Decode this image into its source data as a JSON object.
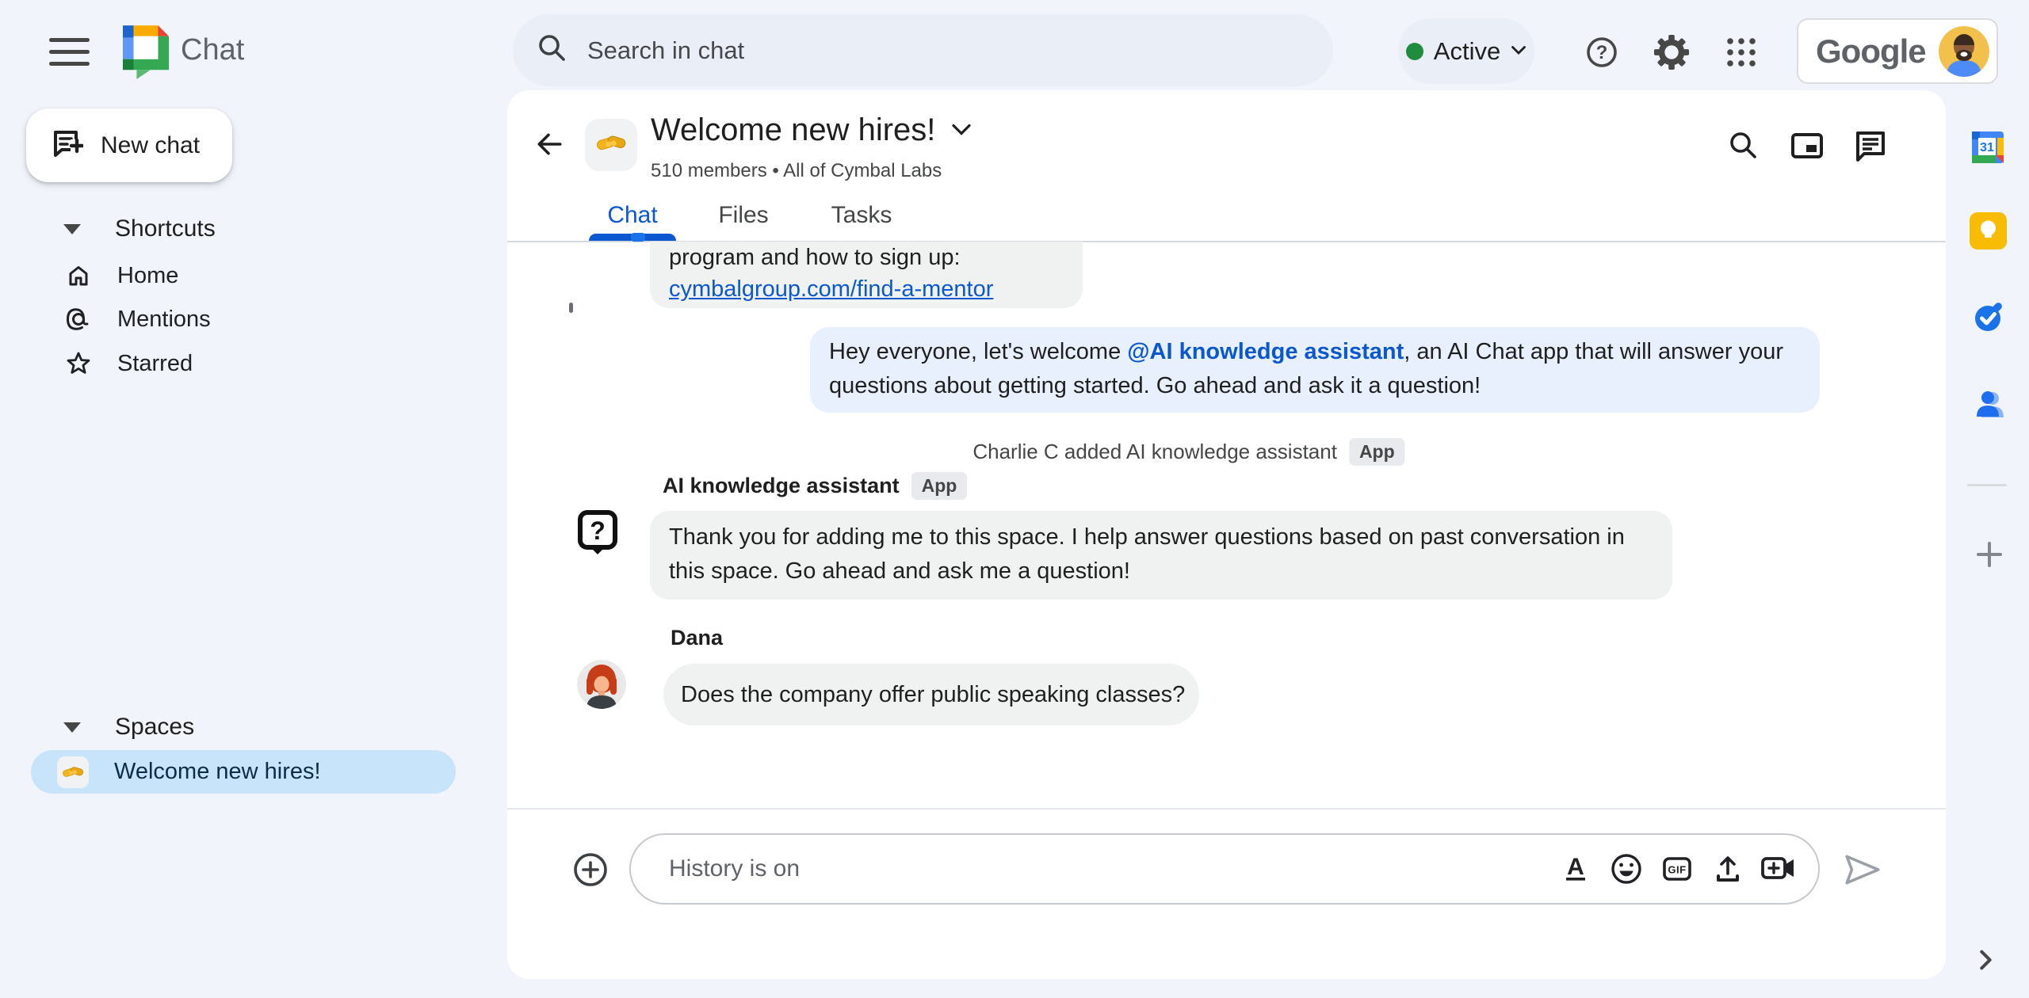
{
  "topbar": {
    "app_name": "Chat",
    "search": {
      "placeholder": "Search in chat"
    },
    "status": {
      "label": "Active"
    },
    "icons": [
      "help-icon",
      "settings-gear-icon",
      "apps-grid-icon"
    ],
    "account": {
      "brand": "Google"
    }
  },
  "sidebar": {
    "new_chat_label": "New chat",
    "shortcuts": {
      "label": "Shortcuts",
      "items": [
        {
          "label": "Home",
          "icon": "home-icon"
        },
        {
          "label": "Mentions",
          "icon": "at-mention-icon"
        },
        {
          "label": "Starred",
          "icon": "star-icon"
        }
      ]
    },
    "spaces": {
      "label": "Spaces",
      "items": [
        {
          "label": "Welcome new hires!",
          "emoji": "handshake",
          "selected": true
        }
      ]
    }
  },
  "chat_header": {
    "title": "Welcome new hires!",
    "emoji": "handshake",
    "subtitle": "510 members  •  All of Cymbal Labs",
    "tabs": [
      {
        "label": "Chat",
        "active": true
      },
      {
        "label": "Files",
        "active": false
      },
      {
        "label": "Tasks",
        "active": false
      }
    ],
    "action_icons": [
      "search-icon",
      "picture-in-picture-icon",
      "chat-threads-icon"
    ]
  },
  "messages": {
    "clipped": {
      "text": "program and how to sign up:",
      "link": "cymbalgroup.com/find-a-mentor"
    },
    "own": {
      "pre": "Hey everyone, let's welcome ",
      "mention": "@AI knowledge assistant",
      "post": ", an AI Chat app that will answer your questions about getting started.  Go ahead and ask it a question!"
    },
    "system": {
      "text": "Charlie C added AI knowledge assistant",
      "badge": "App"
    },
    "ai": {
      "sender": "AI knowledge assistant",
      "badge": "App",
      "avatar": "question-bubble-icon",
      "text": "Thank you for adding me to this space. I help answer questions based on past conversation in this space. Go ahead and ask me a question!"
    },
    "dana": {
      "sender": "Dana",
      "text": "Does the company offer public speaking classes?"
    }
  },
  "composer": {
    "placeholder": "History is on",
    "icons": [
      "add-circle-icon",
      "text-format-icon",
      "emoji-icon",
      "gif-icon",
      "upload-icon",
      "video-meeting-icon",
      "send-icon"
    ]
  },
  "right_rail": {
    "icons": [
      "calendar-icon",
      "keep-icon",
      "tasks-icon",
      "contacts-icon",
      "add-icon"
    ],
    "collapse_icon": "chevron-right-icon"
  },
  "colors": {
    "accent_blue": "#0b57d0",
    "active_dot_green": "#1e8e3e",
    "own_bubble": "#e8f0fe",
    "other_bubble": "#f0f1f1",
    "selected_space_bg": "#c7e4fb",
    "link": "#0b57d0",
    "page_bg": "#f1f4fa"
  }
}
